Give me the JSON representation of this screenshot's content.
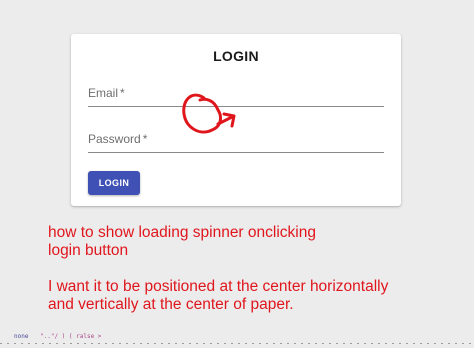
{
  "login_card": {
    "title": "LOGIN",
    "email": {
      "label": "Email",
      "required_mark": "*"
    },
    "password": {
      "label": "Password",
      "required_mark": "*"
    },
    "button_label": "LOGIN"
  },
  "annotation": {
    "stroke_color": "#e0161d"
  },
  "question": {
    "line1": "how to show loading spinner onclicking",
    "line2": "login button",
    "line3": "I want it to be positioned at the center horizontally",
    "line4": "and vertically at the center of paper.",
    "color": "#e0161d"
  },
  "code_strip": {
    "fragment1": "none",
    "fragment2": "\"..\"/ ) ( ralse  >"
  },
  "colors": {
    "background": "#ececec",
    "paper": "#ffffff",
    "button": "#3f51b5"
  }
}
